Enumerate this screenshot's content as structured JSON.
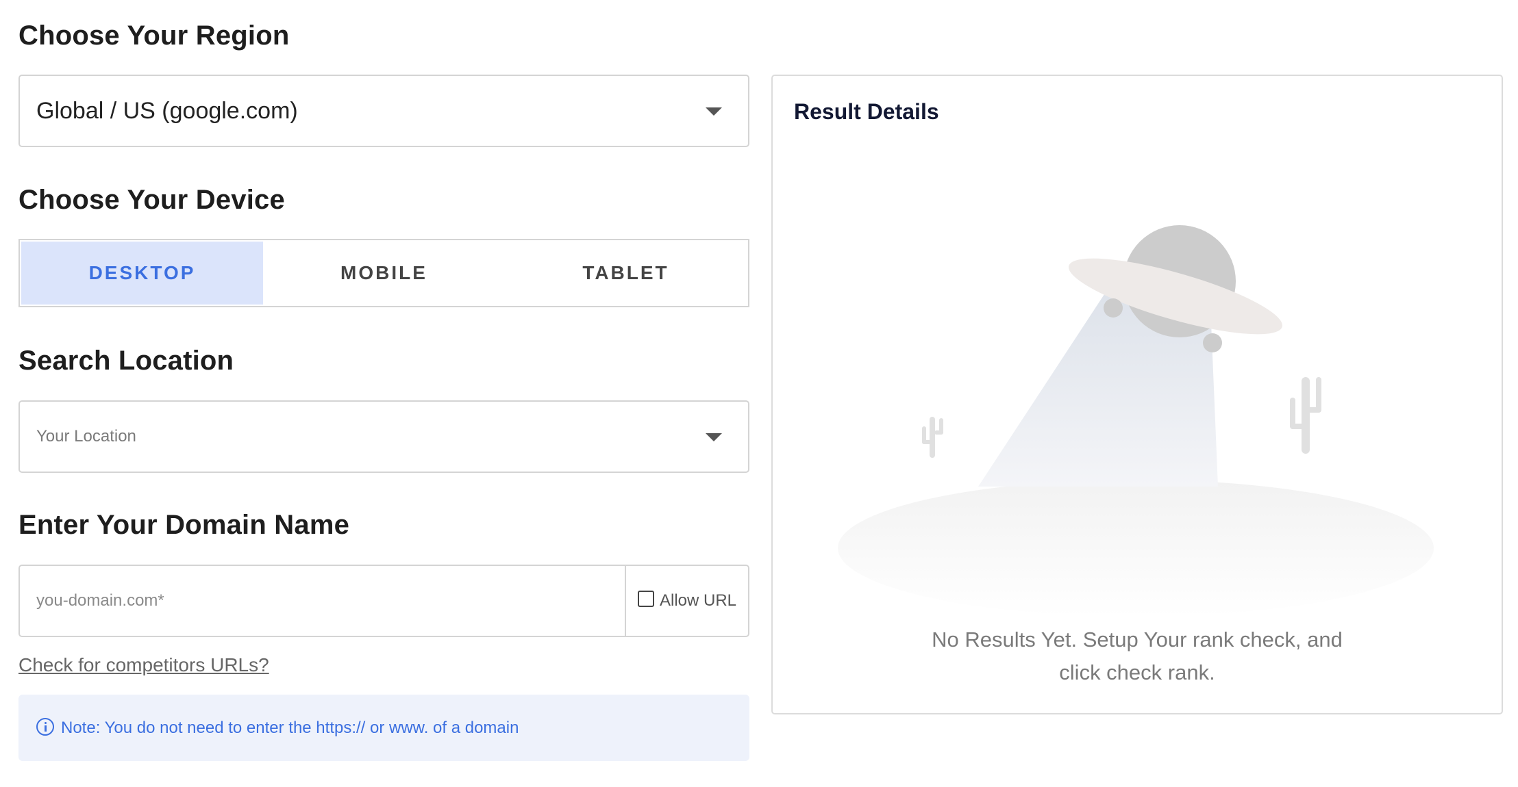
{
  "region": {
    "heading": "Choose Your Region",
    "selected": "Global / US (google.com)"
  },
  "device": {
    "heading": "Choose Your Device",
    "options": [
      "DESKTOP",
      "MOBILE",
      "TABLET"
    ],
    "active": "DESKTOP"
  },
  "location": {
    "heading": "Search Location",
    "placeholder": "Your Location"
  },
  "domain": {
    "heading": "Enter Your Domain Name",
    "placeholder": "you-domain.com*",
    "value": "",
    "allow_url_label": "Allow URL",
    "allow_url_checked": false
  },
  "competitors_link": "Check for competitors URLs?",
  "note": {
    "icon": "info-icon",
    "text": "Note: You do not need to enter the https:// or www. of a domain"
  },
  "results": {
    "title": "Result Details",
    "empty_line1": "No Results Yet. Setup Your rank check, and",
    "empty_line2": "click check rank."
  },
  "colors": {
    "accent": "#3b6fe0",
    "active_tab_bg": "#dbe4fb",
    "note_bg": "#eef2fb"
  }
}
